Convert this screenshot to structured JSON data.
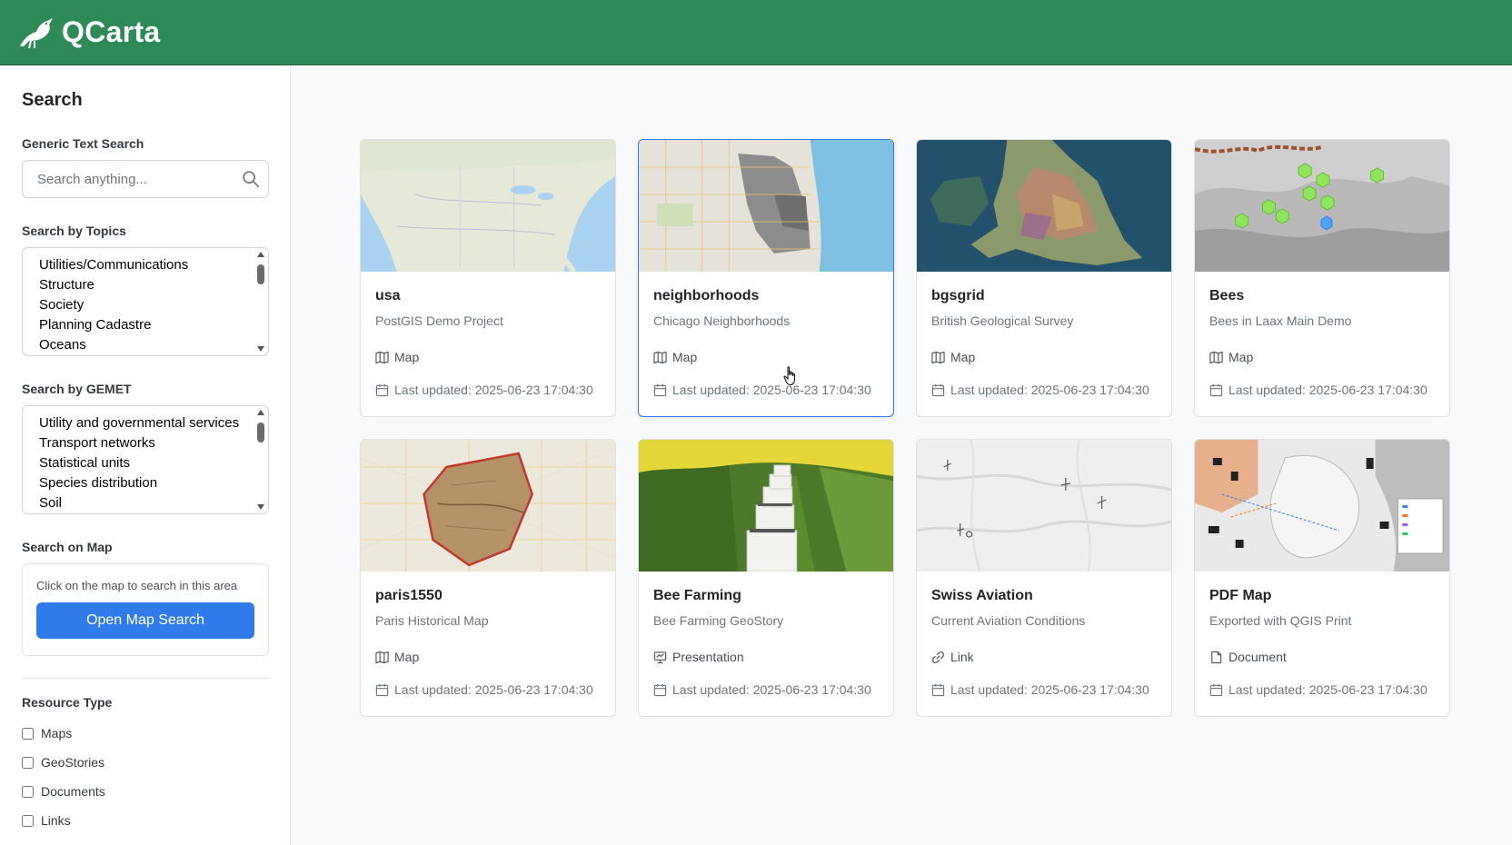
{
  "app": {
    "name": "QCarta"
  },
  "sidebar": {
    "title": "Search",
    "text_search": {
      "label": "Generic Text Search",
      "placeholder": "Search anything..."
    },
    "topics": {
      "label": "Search by Topics",
      "items": [
        "Utilities/Communications",
        "Structure",
        "Society",
        "Planning Cadastre",
        "Oceans"
      ]
    },
    "gemet": {
      "label": "Search by GEMET",
      "items": [
        "Utility and governmental services",
        "Transport networks",
        "Statistical units",
        "Species distribution",
        "Soil"
      ]
    },
    "map_search": {
      "label": "Search on Map",
      "hint": "Click on the map to search in this area",
      "button": "Open Map Search"
    },
    "resource_type": {
      "label": "Resource Type",
      "options": [
        "Maps",
        "GeoStories",
        "Documents",
        "Links"
      ]
    }
  },
  "cards": [
    {
      "title": "usa",
      "subtitle": "PostGIS Demo Project",
      "type": "Map",
      "type_icon": "map-icon",
      "updated": "Last updated: 2025-06-23 17:04:30"
    },
    {
      "title": "neighborhoods",
      "subtitle": "Chicago Neighborhoods",
      "type": "Map",
      "type_icon": "map-icon",
      "updated": "Last updated: 2025-06-23 17:04:30"
    },
    {
      "title": "bgsgrid",
      "subtitle": "British Geological Survey",
      "type": "Map",
      "type_icon": "map-icon",
      "updated": "Last updated: 2025-06-23 17:04:30"
    },
    {
      "title": "Bees",
      "subtitle": "Bees in Laax Main Demo",
      "type": "Map",
      "type_icon": "map-icon",
      "updated": "Last updated: 2025-06-23 17:04:30"
    },
    {
      "title": "paris1550",
      "subtitle": "Paris Historical Map",
      "type": "Map",
      "type_icon": "map-icon",
      "updated": "Last updated: 2025-06-23 17:04:30"
    },
    {
      "title": "Bee Farming",
      "subtitle": "Bee Farming GeoStory",
      "type": "Presentation",
      "type_icon": "presentation-icon",
      "updated": "Last updated: 2025-06-23 17:04:30"
    },
    {
      "title": "Swiss Aviation",
      "subtitle": "Current Aviation Conditions",
      "type": "Link",
      "type_icon": "link-icon",
      "updated": "Last updated: 2025-06-23 17:04:30"
    },
    {
      "title": "PDF Map",
      "subtitle": "Exported with QGIS Print",
      "type": "Document",
      "type_icon": "document-icon",
      "updated": "Last updated: 2025-06-23 17:04:30"
    }
  ],
  "colors": {
    "header": "#2e8b57",
    "accent": "#2f7be9",
    "sidebar_bg": "#ffffff",
    "page_bg": "#f8f9fa"
  }
}
